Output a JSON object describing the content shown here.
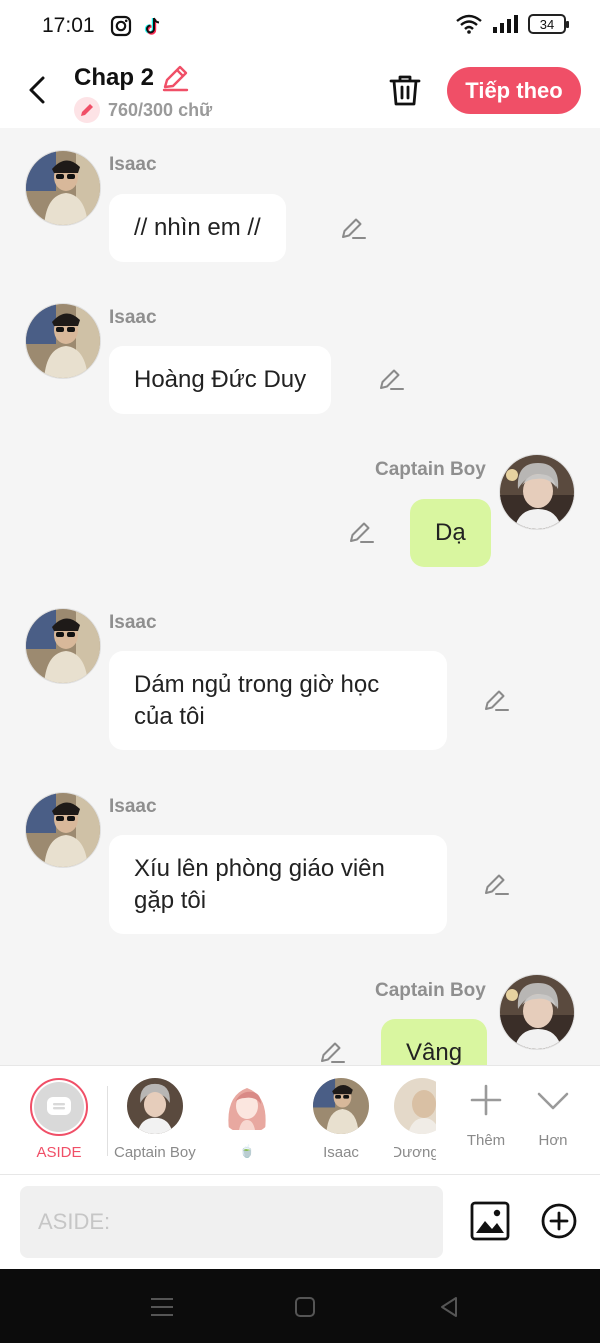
{
  "status_bar": {
    "time": "17:01",
    "battery": "34",
    "icons": [
      "instagram-icon",
      "tiktok-icon",
      "wifi-icon",
      "signal-icon",
      "battery-icon"
    ]
  },
  "header": {
    "title": "Chap 2",
    "word_count": "760/300 chữ",
    "next_label": "Tiếp theo",
    "accent_color": "#f04f67"
  },
  "messages": [
    {
      "sender": "Isaac",
      "text": "// nhìn em //",
      "side": "left"
    },
    {
      "sender": "Isaac",
      "text": "Hoàng Đức Duy",
      "side": "left"
    },
    {
      "sender": "Captain Boy",
      "text": "Dạ",
      "side": "right"
    },
    {
      "sender": "Isaac",
      "text": "Dám ngủ trong giờ học\ncủa tôi",
      "side": "left"
    },
    {
      "sender": "Isaac",
      "text": "Xíu lên phòng giáo viên\ngặp tôi",
      "side": "left"
    },
    {
      "sender": "Captain Boy",
      "text": "Vâng",
      "side": "right"
    }
  ],
  "characters": [
    {
      "label": "ASIDE",
      "selected": true
    },
    {
      "label": "Captain Boy"
    },
    {
      "label": "🍵"
    },
    {
      "label": "Isaac"
    },
    {
      "label": "Dương"
    }
  ],
  "actions": {
    "add_label": "Thêm",
    "more_label": "Hơn"
  },
  "input": {
    "placeholder": "ASIDE:"
  },
  "colors": {
    "right_bubble": "#d9f6a0",
    "left_bubble": "#ffffff",
    "background": "#f5f5f5"
  }
}
